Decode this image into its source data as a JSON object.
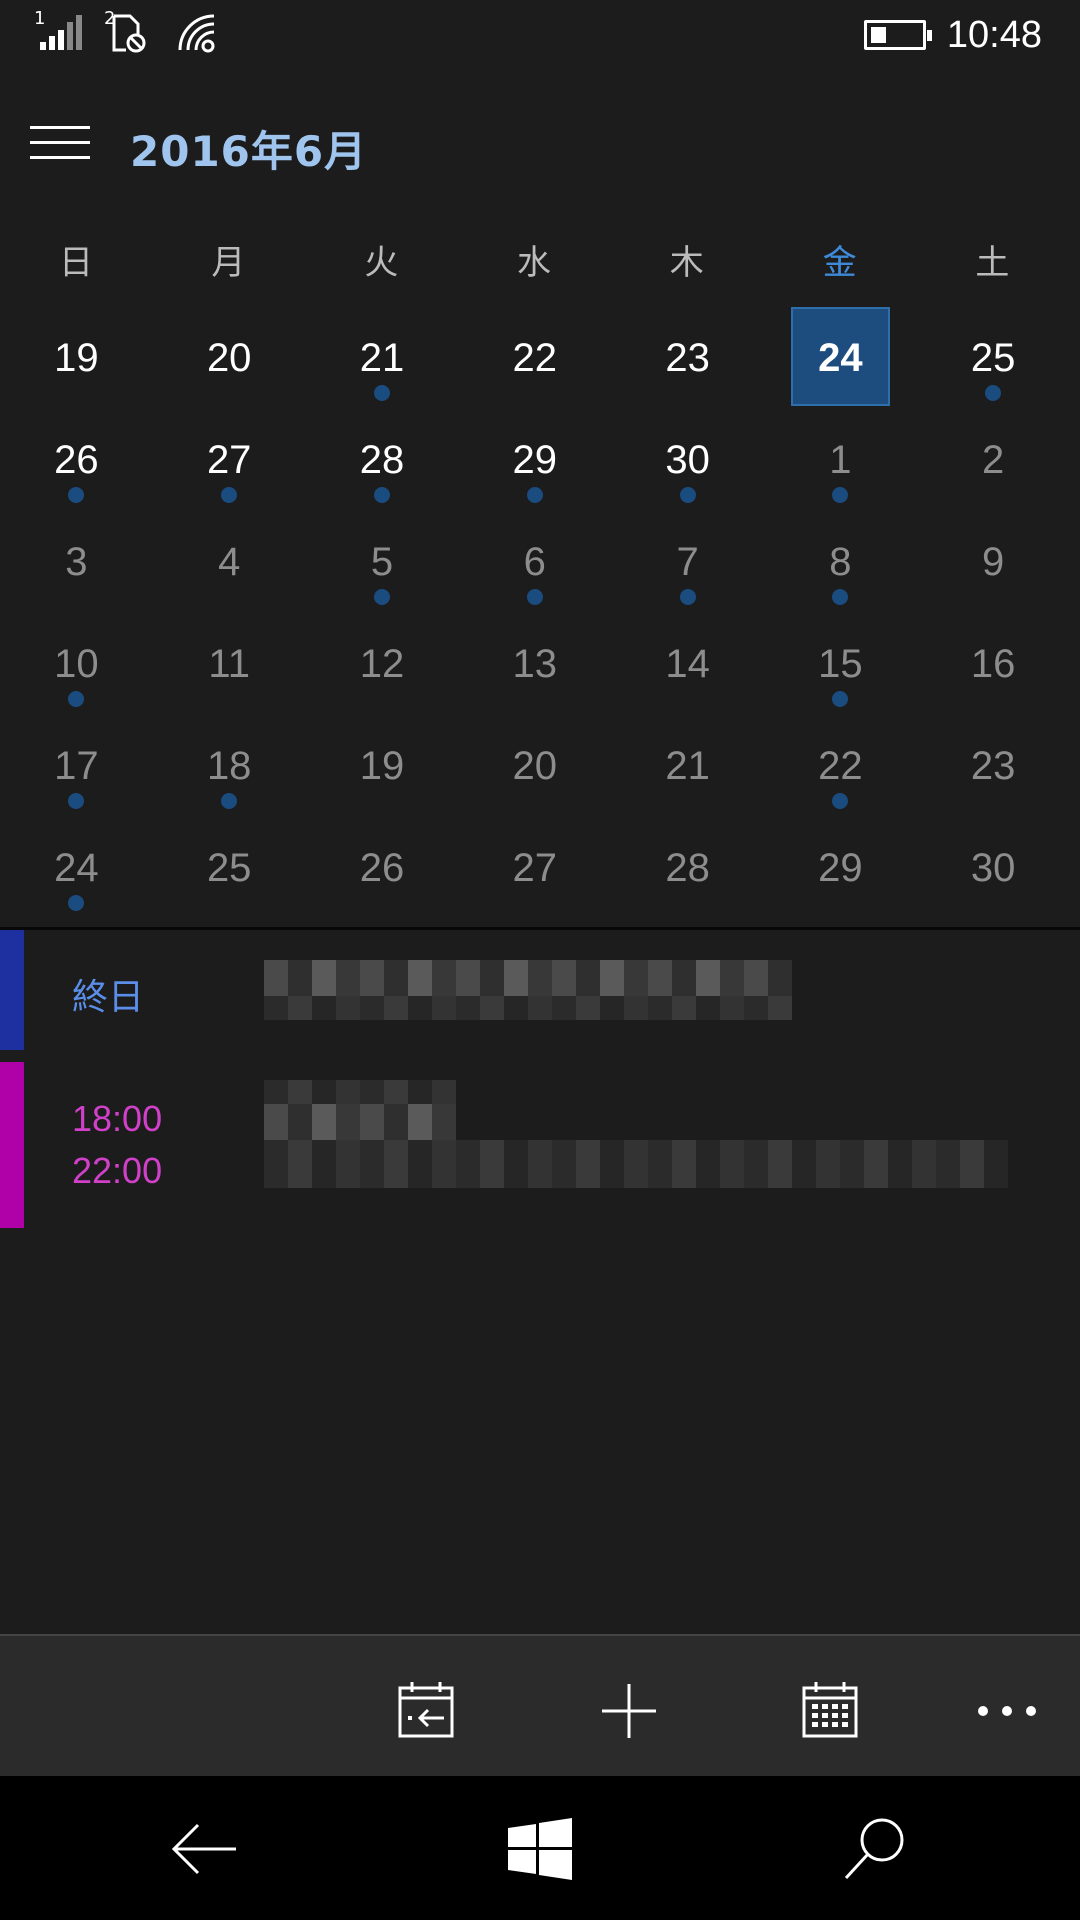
{
  "status_bar": {
    "sim1_label": "1",
    "sim2_label": "2",
    "time": "10:48",
    "battery_level": 0.3
  },
  "header": {
    "title": "2016年6月",
    "menu_icon": "hamburger-icon"
  },
  "weekdays": [
    "日",
    "月",
    "火",
    "水",
    "木",
    "金",
    "土"
  ],
  "today_column": 5,
  "weeks": [
    [
      {
        "d": "19",
        "cur": true,
        "ev": false
      },
      {
        "d": "20",
        "cur": true,
        "ev": false
      },
      {
        "d": "21",
        "cur": true,
        "ev": true
      },
      {
        "d": "22",
        "cur": true,
        "ev": false
      },
      {
        "d": "23",
        "cur": true,
        "ev": false
      },
      {
        "d": "24",
        "cur": true,
        "ev": false,
        "today": true
      },
      {
        "d": "25",
        "cur": true,
        "ev": true
      }
    ],
    [
      {
        "d": "26",
        "cur": true,
        "ev": true
      },
      {
        "d": "27",
        "cur": true,
        "ev": true
      },
      {
        "d": "28",
        "cur": true,
        "ev": true
      },
      {
        "d": "29",
        "cur": true,
        "ev": true
      },
      {
        "d": "30",
        "cur": true,
        "ev": true
      },
      {
        "d": "1",
        "cur": false,
        "ev": true
      },
      {
        "d": "2",
        "cur": false,
        "ev": false
      }
    ],
    [
      {
        "d": "3",
        "cur": false,
        "ev": false
      },
      {
        "d": "4",
        "cur": false,
        "ev": false
      },
      {
        "d": "5",
        "cur": false,
        "ev": true
      },
      {
        "d": "6",
        "cur": false,
        "ev": true
      },
      {
        "d": "7",
        "cur": false,
        "ev": true
      },
      {
        "d": "8",
        "cur": false,
        "ev": true
      },
      {
        "d": "9",
        "cur": false,
        "ev": false
      }
    ],
    [
      {
        "d": "10",
        "cur": false,
        "ev": true
      },
      {
        "d": "11",
        "cur": false,
        "ev": false
      },
      {
        "d": "12",
        "cur": false,
        "ev": false
      },
      {
        "d": "13",
        "cur": false,
        "ev": false
      },
      {
        "d": "14",
        "cur": false,
        "ev": false
      },
      {
        "d": "15",
        "cur": false,
        "ev": true
      },
      {
        "d": "16",
        "cur": false,
        "ev": false
      }
    ],
    [
      {
        "d": "17",
        "cur": false,
        "ev": true
      },
      {
        "d": "18",
        "cur": false,
        "ev": true
      },
      {
        "d": "19",
        "cur": false,
        "ev": false
      },
      {
        "d": "20",
        "cur": false,
        "ev": false
      },
      {
        "d": "21",
        "cur": false,
        "ev": false
      },
      {
        "d": "22",
        "cur": false,
        "ev": true
      },
      {
        "d": "23",
        "cur": false,
        "ev": false
      }
    ],
    [
      {
        "d": "24",
        "cur": false,
        "ev": true
      },
      {
        "d": "25",
        "cur": false,
        "ev": false
      },
      {
        "d": "26",
        "cur": false,
        "ev": false
      },
      {
        "d": "27",
        "cur": false,
        "ev": false
      },
      {
        "d": "28",
        "cur": false,
        "ev": false
      },
      {
        "d": "29",
        "cur": false,
        "ev": false
      },
      {
        "d": "30",
        "cur": false,
        "ev": false
      }
    ]
  ],
  "events": [
    {
      "time_start": "終日",
      "time_end": "",
      "color": "#1e2fa0",
      "text_color": "#5a8ee8"
    },
    {
      "time_start": "18:00",
      "time_end": "22:00",
      "color": "#b000a8",
      "text_color": "#d040c8"
    }
  ],
  "colors": {
    "accent": "#1c4d7e",
    "event_dot": "#1a4c80",
    "header_title": "#9fc5ef"
  },
  "command_bar": {
    "buttons": [
      "today-icon",
      "add-icon",
      "calendar-view-icon",
      "more-icon"
    ]
  },
  "nav_bar": {
    "buttons": [
      "back-icon",
      "windows-start-icon",
      "search-icon"
    ]
  }
}
